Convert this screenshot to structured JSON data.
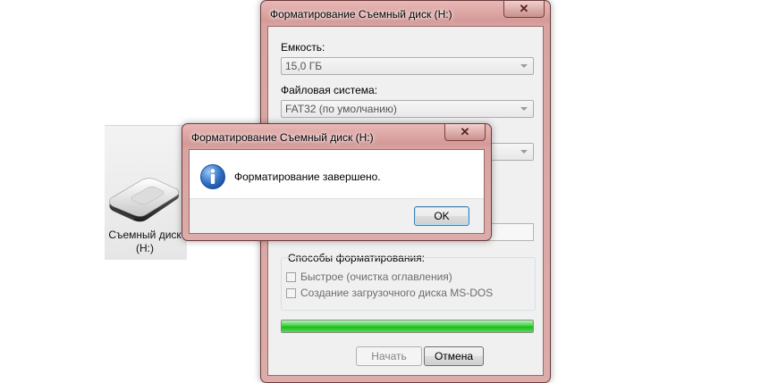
{
  "explorer": {
    "drive_name": "Съемный диск",
    "drive_letter": "(H:)"
  },
  "format_dialog": {
    "title": "Форматирование Съемный диск (H:)",
    "close_glyph": "✕",
    "capacity_label": "Емкость:",
    "capacity_value": "15,0 ГБ",
    "filesystem_label": "Файловая система:",
    "filesystem_value": "FAT32 (по умолчанию)",
    "format_options_label": "Способы форматирования:",
    "quick_format_label": "Быстрое (очистка оглавления)",
    "quick_format_checked": false,
    "msdos_label": "Создание загрузочного диска MS-DOS",
    "msdos_checked": false,
    "progress_percent": 100,
    "start_button": "Начать",
    "cancel_button": "Отмена"
  },
  "message_box": {
    "title": "Форматирование Съемный диск (H:)",
    "close_glyph": "✕",
    "icon": "info-icon",
    "message": "Форматирование завершено.",
    "ok_button": "OK"
  },
  "colors": {
    "window_frame": "#d8a4a2",
    "progress_fill": "#2cc72c",
    "info_icon": "#2f6fc4"
  }
}
